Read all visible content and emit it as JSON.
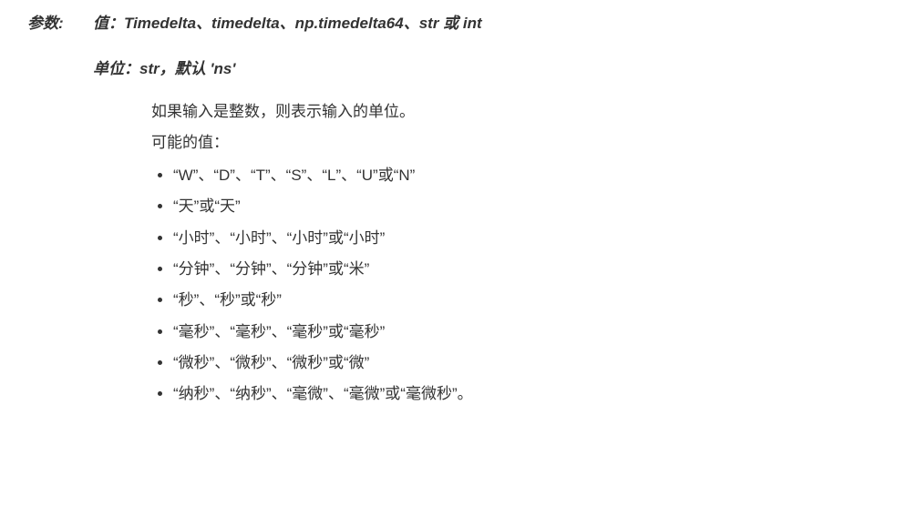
{
  "param_label": "参数:",
  "value_sig": "值：Timedelta、timedelta、np.timedelta64、str 或 int",
  "unit_sig": "单位：str，默认 'ns'",
  "unit_desc1": "如果输入是整数，则表示输入的单位。",
  "unit_desc2": "可能的值：",
  "unit_values": [
    "“W”、“D”、“T”、“S”、“L”、“U”或“N”",
    "“天”或“天”",
    "“小时”、“小时”、“小时”或“小时”",
    "“分钟”、“分钟”、“分钟”或“米”",
    "“秒”、“秒”或“秒”",
    "“毫秒”、“毫秒”、“毫秒”或“毫秒”",
    "“微秒”、“微秒”、“微秒”或“微”",
    "“纳秒”、“纳秒”、“毫微”、“毫微”或“毫微秒”。"
  ]
}
